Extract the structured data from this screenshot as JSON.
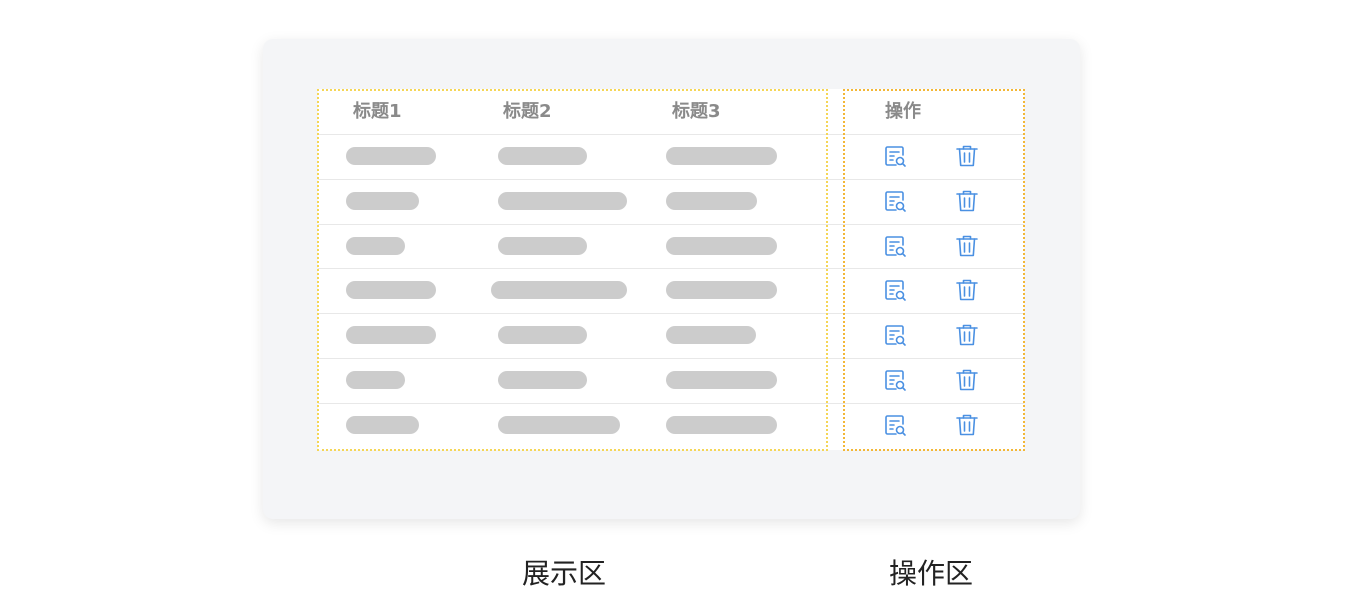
{
  "table": {
    "headers": {
      "col1": "标题1",
      "col2": "标题2",
      "col3": "标题3",
      "actions": "操作"
    },
    "row_count": 7,
    "row_actions": [
      "view-details-icon",
      "delete-trash-icon"
    ]
  },
  "zones": {
    "display": "展示区",
    "action": "操作区"
  },
  "colors": {
    "card_bg": "#f4f5f7",
    "placeholder": "#cccccc",
    "icon_blue": "#4a90e2",
    "display_border": "#f5d657",
    "action_border": "#f3b736"
  }
}
